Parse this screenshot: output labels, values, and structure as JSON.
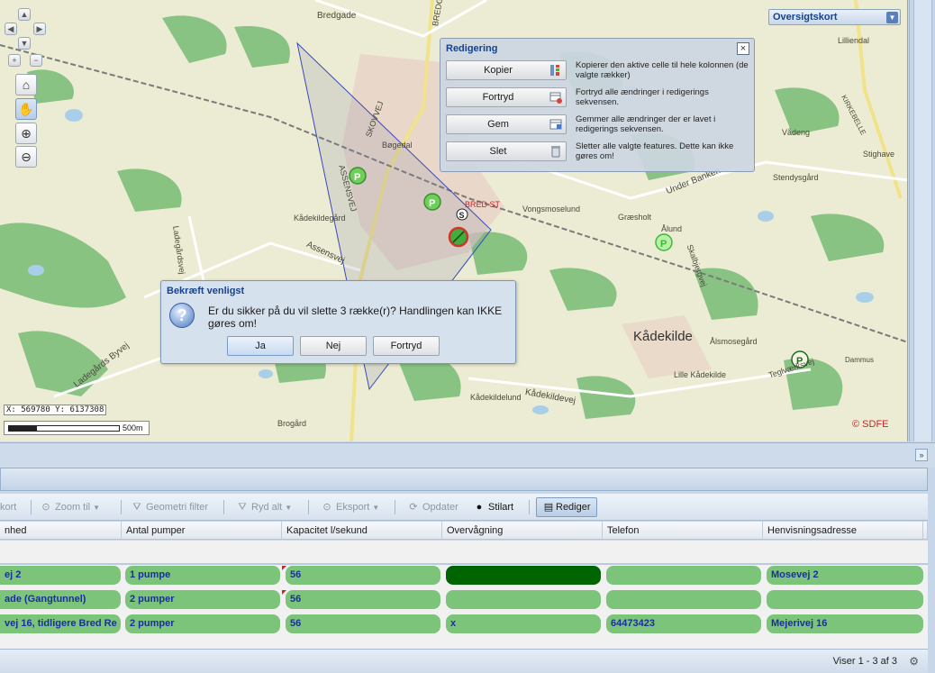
{
  "map": {
    "coordinates": "X: 569780 Y: 6137308",
    "scale_label": "500m",
    "copyright": "© SDFE",
    "labels": {
      "bredgade": "Bredgade",
      "bredgade2": "BREDGADE",
      "lilliendal": "Lilliendal",
      "boegedal": "Bøgedal",
      "skovvej": "SKOVVEJ",
      "assensvej": "ASSENSVEJ",
      "assensvej2": "Assensvej",
      "kaadekildegaard": "Kådekildegård",
      "bred_st": "BRED ST",
      "vongsmoselund": "Vongsmoselund",
      "graesholt": "Græsholt",
      "aalund": "Ålund",
      "under_banken": "Under Banken",
      "skalbjergvej": "Skalbjergvej",
      "vaadeng": "Vådeng",
      "stendysgaard": "Stendysgård",
      "stighave": "Stighave",
      "kirkebelle": "KIRKEBELLE",
      "kaadekilde": "Kådekilde",
      "aalsmosegaard": "Ålsmosegård",
      "tegvaerksvej": "Teglværksvej",
      "dammus": "Dammus",
      "lille_kaadekilde": "Lille Kådekilde",
      "kaadekildevej": "Kådekildevej",
      "kaadekildelund": "Kådekildelund",
      "ladegaardsvej": "Ladegårdsvej",
      "ladegaards_byvej": "Ladegårds Byvej",
      "brogaard": "Brogård"
    }
  },
  "overview": {
    "title": "Oversigtskort"
  },
  "edit_panel": {
    "title": "Redigering",
    "rows": [
      {
        "label": "Kopier",
        "desc": "Kopierer den aktive celle til hele kolonnen (de valgte rækker)"
      },
      {
        "label": "Fortryd",
        "desc": "Fortryd alle ændringer i redigerings sekvensen."
      },
      {
        "label": "Gem",
        "desc": "Gemmer alle ændringer der er lavet i redigerings sekvensen."
      },
      {
        "label": "Slet",
        "desc": "Sletter alle valgte features. Dette kan ikke gøres om!"
      }
    ]
  },
  "confirm": {
    "title": "Bekræft venligst",
    "message": "Er du sikker på du vil slette 3 række(r)? Handlingen kan IKKE gøres om!",
    "buttons": {
      "yes": "Ja",
      "no": "Nej",
      "cancel": "Fortryd"
    }
  },
  "toolbar": {
    "kort": "kort",
    "zoom_til": "Zoom til",
    "geometri_filter": "Geometri filter",
    "ryd_alt": "Ryd alt",
    "eksport": "Eksport",
    "opdater": "Opdater",
    "stilart": "Stilart",
    "rediger": "Rediger"
  },
  "grid": {
    "columns": [
      "nhed",
      "Antal pumper",
      "Kapacitet l/sekund",
      "Overvågning",
      "Telefon",
      "Henvisningsadresse"
    ],
    "rows": [
      [
        "ej 2",
        "1 pumpe",
        "56",
        "",
        "",
        "Mosevej 2"
      ],
      [
        "ade (Gangtunnel)",
        "2 pumper",
        "56",
        "",
        "",
        ""
      ],
      [
        "vej 16, tidligere Bred Re",
        "2 pumper",
        "56",
        "x",
        "64473423",
        "Mejerivej 16"
      ]
    ],
    "status": "Viser 1 - 3 af 3"
  }
}
